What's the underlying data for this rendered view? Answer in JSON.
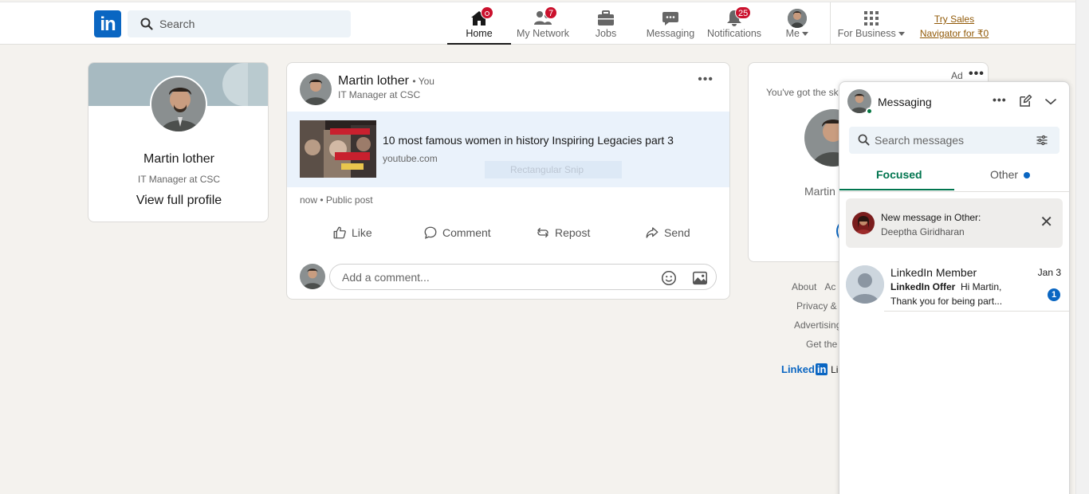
{
  "nav": {
    "search_placeholder": "Search",
    "items": [
      {
        "label": "Home",
        "badge": ""
      },
      {
        "label": "My Network",
        "badge": "7"
      },
      {
        "label": "Jobs",
        "badge": ""
      },
      {
        "label": "Messaging",
        "badge": ""
      },
      {
        "label": "Notifications",
        "badge": "25"
      },
      {
        "label": "Me",
        "badge": ""
      },
      {
        "label": "For Business",
        "badge": ""
      }
    ],
    "try_sales": "Try Sales Navigator for ₹0"
  },
  "profile": {
    "name": "Martin lother",
    "headline": "IT Manager at CSC",
    "view_profile": "View full profile"
  },
  "post": {
    "author": "Martin lother",
    "you": "• You",
    "headline": "IT Manager at CSC",
    "link_title": "10 most famous women in history Inspiring Legacies part 3",
    "link_host": "youtube.com",
    "snip_overlay": "Rectangular Snip",
    "meta": "now • Public post",
    "actions": {
      "like": "Like",
      "comment": "Comment",
      "repost": "Repost",
      "send": "Send"
    },
    "comment_placeholder": "Add a comment..."
  },
  "ad": {
    "label": "Ad",
    "text": "You've got the ski",
    "name": "Martin"
  },
  "footer": {
    "about": "About",
    "accessibility": "Ac",
    "privacy": "Privacy &",
    "advertising": "Advertising",
    "get_app": "Get the",
    "brand": "Linked",
    "brand_suffix": "in",
    "brand_tail": "Li"
  },
  "messaging": {
    "title": "Messaging",
    "search_placeholder": "Search messages",
    "tabs": {
      "focused": "Focused",
      "other": "Other"
    },
    "notice": {
      "title": "New message in Other:",
      "from": "Deeptha Giridharan"
    },
    "conversations": [
      {
        "name": "LinkedIn Member",
        "date": "Jan 3",
        "sender": "LinkedIn Offer",
        "preview1": "Hi Martin,",
        "preview2": "Thank you for being part...",
        "unread": "1"
      }
    ]
  },
  "colors": {
    "brand": "#0a66c2",
    "badge": "#cb112d",
    "focused_tab": "#01754f",
    "try_sales": "#915907"
  }
}
